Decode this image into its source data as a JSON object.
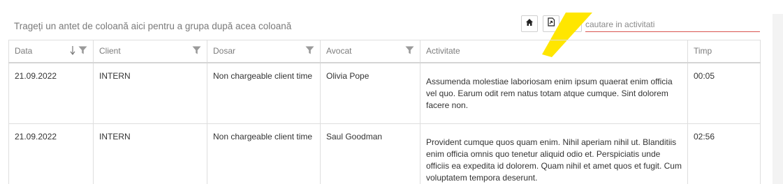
{
  "group_panel": {
    "hint": "Trageți un antet de coloană aici pentru a grupa după acea coloană"
  },
  "toolbar": {
    "home_icon": "home-icon",
    "export_icon": "export-pdf-icon",
    "columns_icon": "column-chooser-icon",
    "search_placeholder": "cautare in activitati",
    "highlight_color": "#ffe600"
  },
  "columns": [
    {
      "label": "Data",
      "sort": "descending",
      "filter": true
    },
    {
      "label": "Client",
      "filter": true
    },
    {
      "label": "Dosar",
      "filter": true
    },
    {
      "label": "Avocat",
      "filter": true
    },
    {
      "label": "Activitate",
      "filter": false
    },
    {
      "label": "Timp",
      "filter": false
    }
  ],
  "rows": [
    {
      "data": "21.09.2022",
      "client": "INTERN",
      "dosar": "Non chargeable client time",
      "avocat": "Olivia Pope",
      "activitate": "Assumenda molestiae laboriosam enim ipsum quaerat enim officia vel quo. Earum odit rem natus totam atque cumque. Sint dolorem facere non.",
      "timp": "00:05"
    },
    {
      "data": "21.09.2022",
      "client": "INTERN",
      "dosar": "Non chargeable client time",
      "avocat": "Saul Goodman",
      "activitate": "Provident cumque quos quam enim. Nihil aperiam nihil ut. Blanditiis enim officia omnis quo tenetur aliquid odio et. Perspiciatis unde officiis ea expedita id dolorem. Quam nihil et amet quos et fugit. Cum voluptatem tempora deserunt.",
      "timp": "02:56"
    }
  ]
}
